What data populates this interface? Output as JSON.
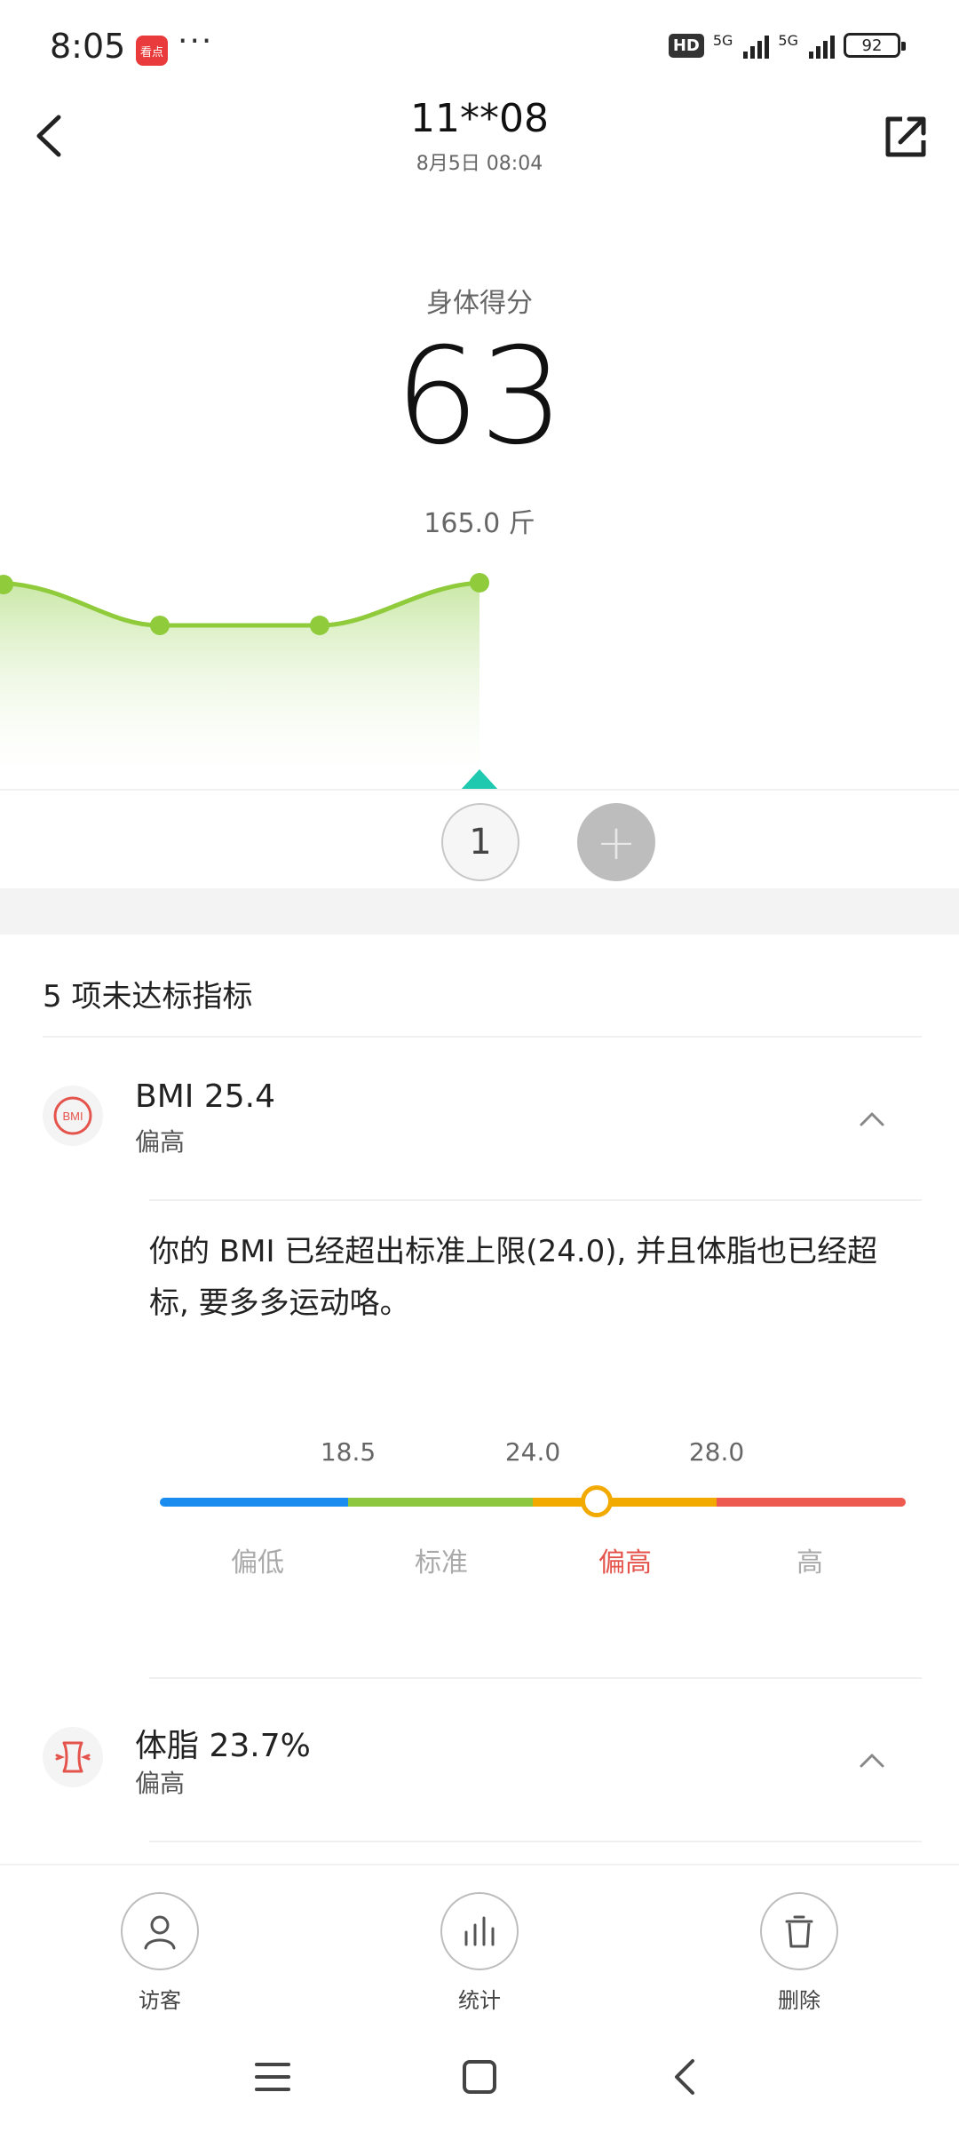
{
  "status_bar": {
    "time": "8:05",
    "app_badge": "看点",
    "more": "···",
    "hd": "HD",
    "network_1": "5G",
    "network_2": "5G",
    "battery": "92"
  },
  "header": {
    "title": "11**08",
    "subtitle": "8月5日 08:04",
    "back_icon": "chevron-left-icon",
    "share_icon": "share-external-icon"
  },
  "score": {
    "label": "身体得分",
    "value": "63",
    "weight": "165.0 斤"
  },
  "trend": {
    "line_color": "#8fcb3a",
    "indicator_color": "#1ec9b0"
  },
  "record_chips": {
    "current": "1",
    "add": "+"
  },
  "indicators": {
    "title": "5 项未达标指标",
    "items": [
      {
        "icon": "bmi-icon",
        "icon_text": "BMI",
        "name": "BMI  25.4",
        "status": "偏高",
        "expanded": true,
        "description": "你的 BMI 已经超出标准上限(24.0), 并且体脂也已经超标, 要多多运动咯。",
        "scale": {
          "ticks": [
            "18.5",
            "24.0",
            "28.0"
          ],
          "labels": [
            "偏低",
            "标准",
            "偏高",
            "高"
          ],
          "active_label": "偏高",
          "value": 25.4,
          "colors": [
            "#1a8cf0",
            "#8dc63f",
            "#f2a900",
            "#ec5a50"
          ]
        }
      },
      {
        "icon": "body-fat-icon",
        "name": "体脂  23.7%",
        "status": "偏高",
        "expanded": true
      }
    ]
  },
  "actions": [
    {
      "label": "访客",
      "icon": "user-icon"
    },
    {
      "label": "统计",
      "icon": "bar-chart-icon"
    },
    {
      "label": "删除",
      "icon": "trash-icon"
    }
  ],
  "nav_bar": {
    "menu": "menu-icon",
    "home": "home-icon",
    "back": "back-icon"
  }
}
